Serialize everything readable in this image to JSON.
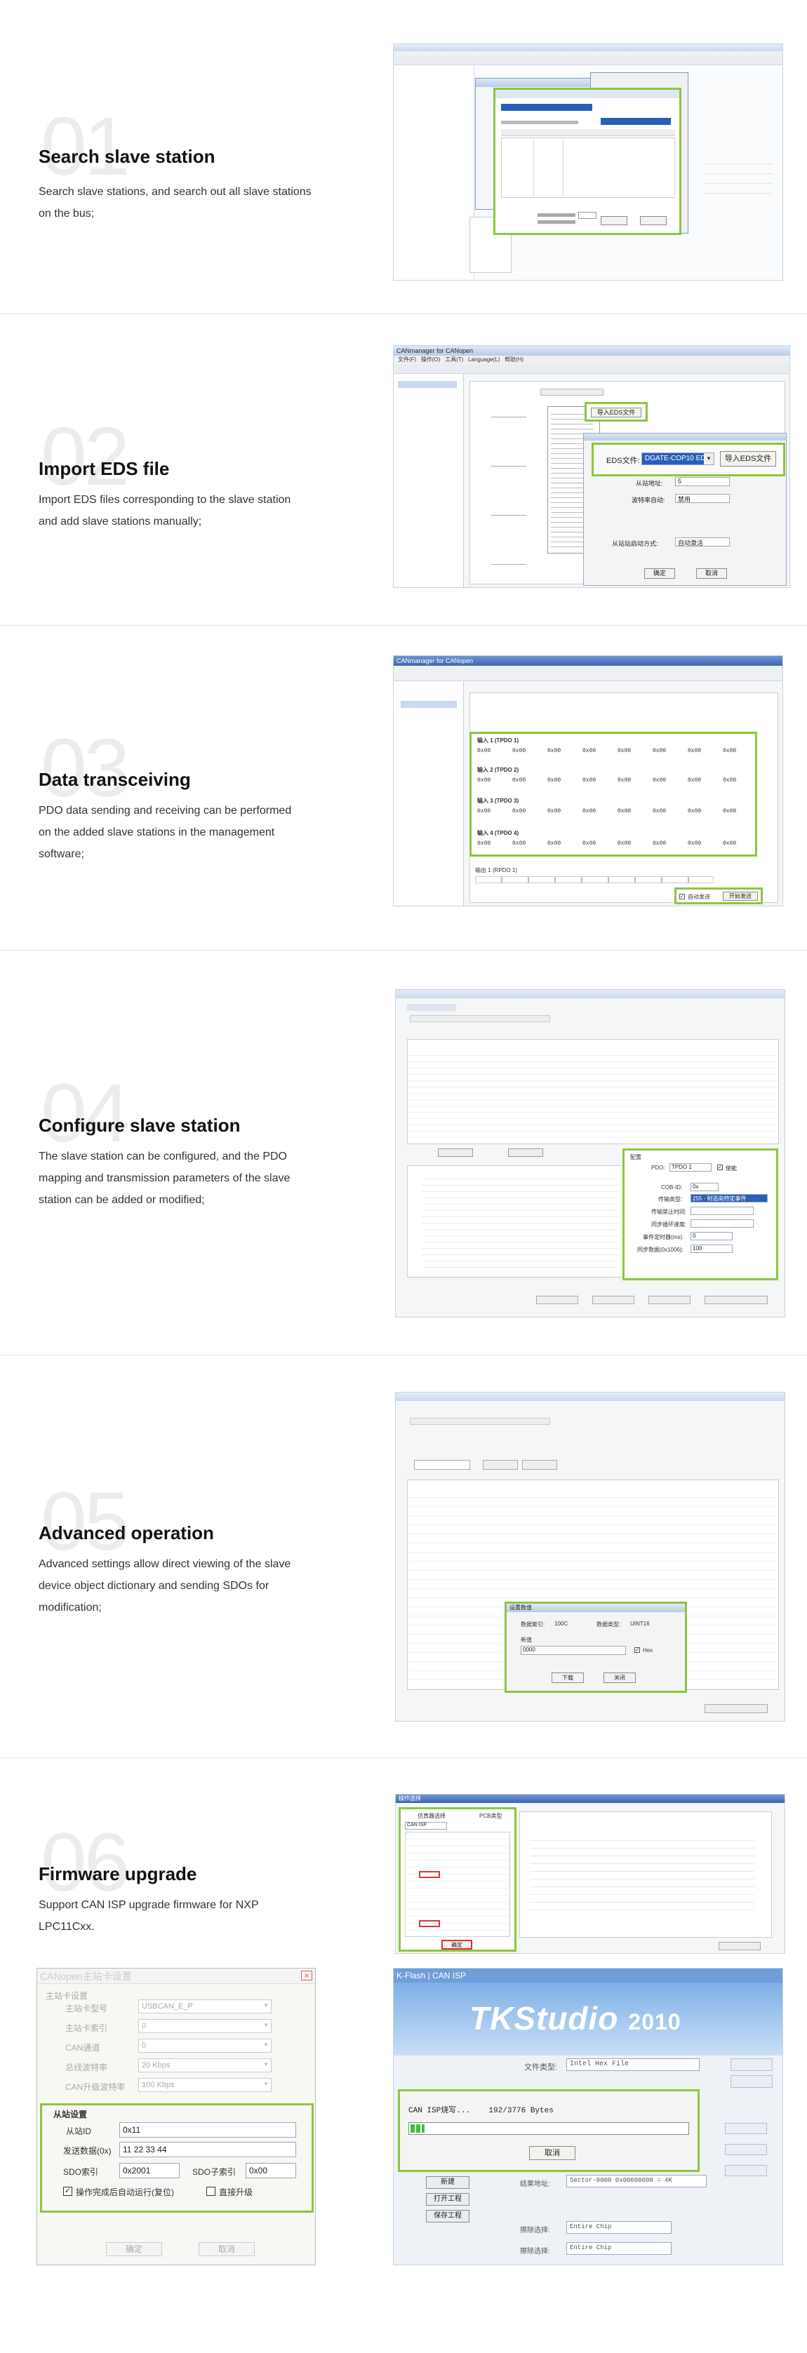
{
  "sections": [
    {
      "number": "01",
      "title": "Search slave station",
      "description": "Search slave stations, and search out all slave stations on the bus;"
    },
    {
      "number": "02",
      "title": "Import EDS file",
      "description": "Import EDS files corresponding to the slave station and add slave stations manually;"
    },
    {
      "number": "03",
      "title": "Data transceiving",
      "description": "PDO data sending and receiving can be performed on the added slave stations in the management software;"
    },
    {
      "number": "04",
      "title": "Configure slave station",
      "description": "The slave station can be configured, and the PDO mapping and transmission parameters of the slave station can be added or modified;"
    },
    {
      "number": "05",
      "title": "Advanced operation",
      "description": "Advanced settings allow direct viewing of the slave device object dictionary and sending SDOs for modification;"
    },
    {
      "number": "06",
      "title": "Firmware upgrade",
      "description": "Support CAN ISP upgrade firmware for NXP LPC11Cxx."
    }
  ],
  "shot2": {
    "window_title": "CANmanager for CANopen",
    "menu": [
      "文件(F)",
      "操作(O)",
      "工具(T)",
      "Language(L)",
      "帮助(H)"
    ],
    "import_button": "导入EDS文件",
    "eds_label": "EDS文件:",
    "eds_value": "DGATE-COP10 EDS",
    "eds_import_button": "导入EDS文件",
    "station_label": "从站地址:",
    "station_value": "5",
    "baud_label": "波特率自动:",
    "baud_value": "禁用",
    "mode_label": "从站站启动方式:",
    "mode_value": "自动激活",
    "ok": "确定",
    "cancel": "取消"
  },
  "shot3": {
    "window_title": "CANmanager for CANopen",
    "groups": [
      {
        "name": "输入 1 (TPDO 1)",
        "values": [
          "0x00",
          "0x00",
          "0x00",
          "0x00",
          "0x00",
          "0x00",
          "0x00",
          "0x00"
        ]
      },
      {
        "name": "输入 2 (TPDO 2)",
        "values": [
          "0x00",
          "0x00",
          "0x00",
          "0x00",
          "0x00",
          "0x00",
          "0x00",
          "0x00"
        ]
      },
      {
        "name": "输入 3 (TPDO 3)",
        "values": [
          "0x00",
          "0x00",
          "0x00",
          "0x00",
          "0x00",
          "0x00",
          "0x00",
          "0x00"
        ]
      },
      {
        "name": "输入 4 (TPDO 4)",
        "values": [
          "0x00",
          "0x00",
          "0x00",
          "0x00",
          "0x00",
          "0x00",
          "0x00",
          "0x00"
        ]
      }
    ],
    "output_group": "输出 1 (RPDO 1)",
    "auto_send": "自动发送",
    "start_send": "开始发送"
  },
  "shot4": {
    "config_title": "配置",
    "pdo_label": "PDO:",
    "pdo_value": "TPDO 1",
    "enable_label": "使能",
    "cob_label": "COB-ID:",
    "cob_value": "0x",
    "type_label": "传输类型:",
    "type_value": "255 - 制造商特定事件",
    "inhibit_label": "传输禁止时间:",
    "sync_label": "同步循环速度:",
    "event_label": "事件定时器(ms):",
    "event_value": "0",
    "sync_start_label": "同步数据(0x1006):",
    "sync_start_value": "100"
  },
  "shot5": {
    "dialog_title": "设置数值",
    "index_label": "数据索引:",
    "index_value": "100C",
    "type_label": "数据类型:",
    "type_value": "UINT16",
    "new_value_label": "新值",
    "new_value": "0000",
    "hex_label": "Hex",
    "download": "下载",
    "close": "关闭"
  },
  "shot6a": {
    "title": "操作选择",
    "col1": "仿真器选择",
    "col2": "PCB类型",
    "combo_value": "CAN ISP",
    "confirm": "确定"
  },
  "shot6b": {
    "window_title": "CANopen主站卡设置",
    "master_group": "主站卡设置",
    "fields": [
      {
        "label": "主站卡型号",
        "value": "USBCAN_E_P"
      },
      {
        "label": "主站卡索引",
        "value": "0"
      },
      {
        "label": "CAN通道",
        "value": "0"
      },
      {
        "label": "总线波特率",
        "value": "20 Kbps"
      },
      {
        "label": "CAN升级波特率",
        "value": "100 Kbps"
      }
    ],
    "slave_group": "从站设置",
    "slave_id_label": "从站ID",
    "slave_id_value": "0x11",
    "send_data_label": "发送数据(0x)",
    "send_data_value": "11 22 33 44",
    "sdo_index_label": "SDO索引",
    "sdo_index_value": "0x2001",
    "sdo_sub_label": "SDO子索引",
    "sdo_sub_value": "0x00",
    "auto_run_label": "操作完成后自动运行(复位)",
    "direct_upgrade_label": "直接升级",
    "ok": "确定",
    "cancel": "取消"
  },
  "shot6c": {
    "window_title": "K-Flash | CAN ISP",
    "logo": "TKStudio",
    "year": "2010",
    "file_type_label": "文件类型:",
    "file_type_value": "Intel Hex File",
    "progress_label": "CAN ISP烧写...",
    "progress_value": "192/3776 Bytes",
    "progress": 0.05,
    "cancel": "取消",
    "erase_label": "结果地址:",
    "erase_value": "Sector-0000 0x00000000 = 4K",
    "chip_label": "擦除选择:",
    "chip_value": "Entire Chip",
    "buttons": [
      "新建",
      "打开工程",
      "保存工程"
    ]
  },
  "colors": {
    "accent": "#8dc63f",
    "divider": "#e4e4e4",
    "number": "#ececec",
    "winbar": "#b9cbe6"
  }
}
